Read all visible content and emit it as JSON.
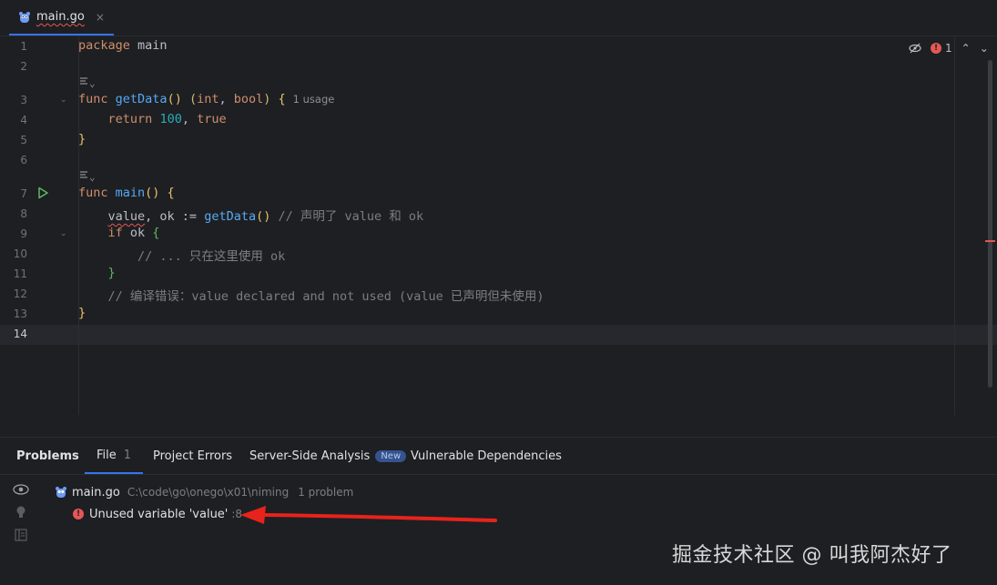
{
  "tab": {
    "filename": "main.go",
    "close": "×",
    "icon": "gopher-icon"
  },
  "inspection": {
    "error_count": "1",
    "up": "⌃",
    "down": "⌄"
  },
  "editor": {
    "line_numbers": [
      "1",
      "2",
      "3",
      "4",
      "5",
      "6",
      "7",
      "8",
      "9",
      "10",
      "11",
      "12",
      "13",
      "14"
    ],
    "lines": {
      "l1_kw": "package",
      "l1_rest": " main",
      "l3_kw": "func",
      "l3_fn": "getData",
      "l3_paren": "()",
      "l3_ret_open": " (",
      "l3_t1": "int",
      "l3_comma": ", ",
      "l3_t2": "bool",
      "l3_ret_close": ")",
      "l3_brace": " {",
      "l3_usage": "1 usage",
      "l4_kw": "return",
      "l4_num": "100",
      "l4_comma": ", ",
      "l4_true": "true",
      "l5": "}",
      "l7_kw": "func",
      "l7_fn": "main",
      "l7_rest": "() {",
      "l8_var": "value",
      "l8_mid": ", ok := ",
      "l8_fn": "getData",
      "l8_paren": "()",
      "l8_comment": " // 声明了 value 和 ok",
      "l9_kw": "if",
      "l9_rest": " ok ",
      "l9_brace": "{",
      "l10": "// ... 只在这里使用 ok",
      "l11": "}",
      "l12": "// 编译错误：value declared and not used (value 已声明但未使用)",
      "l13": "}"
    }
  },
  "problems": {
    "tabs": [
      {
        "label": "Problems"
      },
      {
        "label": "File",
        "count": "1"
      },
      {
        "label": "Project Errors"
      },
      {
        "label": "Server-Side Analysis",
        "badge": "New"
      },
      {
        "label": "Vulnerable Dependencies"
      }
    ],
    "file": {
      "name": "main.go",
      "path": "C:\\code\\go\\onego\\x01\\niming",
      "count": "1 problem"
    },
    "issue": {
      "message": "Unused variable 'value'",
      "line": ":8"
    }
  },
  "annotation": {
    "arrow_color": "#e8231b"
  },
  "watermark": "掘金技术社区 @ 叫我阿杰好了"
}
